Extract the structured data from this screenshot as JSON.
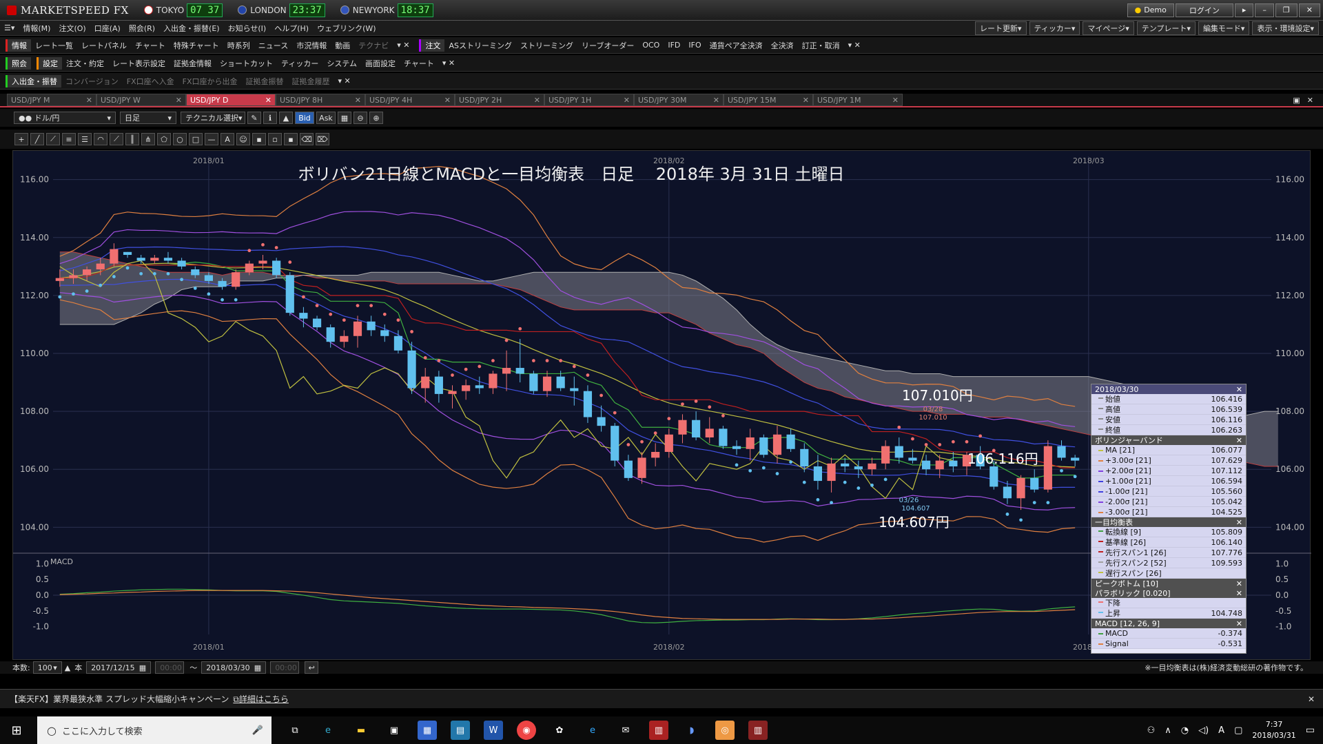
{
  "app": {
    "logo": "MARKETSPEED FX",
    "clocks": [
      {
        "city": "TOKYO",
        "time": "07 37",
        "color": "#cc2222"
      },
      {
        "city": "LONDON",
        "time": "23:37",
        "color": "#2244aa"
      },
      {
        "city": "NEWYORK",
        "time": "18:37",
        "color": "#2244aa"
      }
    ],
    "demo": "Demo",
    "login": "ログイン"
  },
  "menu": [
    "情報(M)",
    "注文(O)",
    "口座(A)",
    "照会(R)",
    "入出金・振替(E)",
    "お知らせ(I)",
    "ヘルプ(H)",
    "ウェブリンク(W)"
  ],
  "rightmenus": [
    "レート更新▾",
    "ティッカー▾",
    "マイページ▾",
    "テンプレート▾",
    "編集モード▾",
    "表示・環境設定▾"
  ],
  "toolbar1": {
    "group": "情報",
    "items": [
      "レート一覧",
      "レートパネル",
      "チャート",
      "特殊チャート",
      "時系列",
      "ニュース",
      "市況情報",
      "動画",
      "テクナビ"
    ],
    "group2": "注文",
    "items2": [
      "ASストリーミング",
      "ストリーミング",
      "リーブオーダー",
      "OCO",
      "IFD",
      "IFO",
      "通貨ペア全決済",
      "全決済",
      "訂正・取消"
    ]
  },
  "toolbar2": {
    "group": "照会",
    "group2": "設定",
    "items": [
      "注文・約定",
      "レート表示設定",
      "証拠金情報",
      "ショートカット",
      "ティッカー",
      "システム",
      "画面設定",
      "チャート"
    ]
  },
  "toolbar3": {
    "group": "入出金・振替",
    "items": [
      "コンバージョン",
      "FX口座へ入金",
      "FX口座から出金",
      "証拠金振替",
      "証拠金履歴"
    ]
  },
  "tabs": [
    "USD/JPY M",
    "USD/JPY W",
    "USD/JPY D",
    "USD/JPY 8H",
    "USD/JPY 4H",
    "USD/JPY 2H",
    "USD/JPY 1H",
    "USD/JPY 30M",
    "USD/JPY 15M",
    "USD/JPY 1M"
  ],
  "controls": {
    "pair": "ドル/円",
    "period": "日足",
    "tech": "テクニカル選択",
    "bid": "Bid",
    "ask": "Ask"
  },
  "chart_data": {
    "type": "candlestick",
    "title": "ボリバン21日線とMACDと一目均衡表　日足　 2018年 3月 31日 土曜日",
    "ylim": [
      103.2,
      116.8
    ],
    "yticks": [
      "116.00",
      "114.00",
      "112.00",
      "110.00",
      "108.00",
      "106.00",
      "104.00"
    ],
    "xticks": [
      "2018/01",
      "2018/02",
      "2018/03"
    ],
    "xtick_index": [
      11,
      45,
      76
    ],
    "annotations": {
      "high_label": "107.010円",
      "high_small": "03/28",
      "high_small2": "107.010",
      "close_label": "106.116円",
      "low_label": "104.607円",
      "low_small": "03/26",
      "low_small2": "104.607"
    },
    "candles": [
      [
        112.5,
        112.9,
        112.3,
        112.6
      ],
      [
        112.6,
        112.9,
        112.4,
        112.7
      ],
      [
        112.7,
        113.0,
        112.5,
        112.9
      ],
      [
        112.9,
        113.3,
        112.7,
        113.1
      ],
      [
        113.1,
        113.8,
        113.0,
        113.6
      ],
      [
        113.5,
        113.5,
        113.3,
        113.4
      ],
      [
        113.3,
        113.4,
        113.1,
        113.2
      ],
      [
        113.2,
        113.4,
        113.1,
        113.3
      ],
      [
        113.3,
        113.5,
        113.1,
        113.2
      ],
      [
        113.2,
        113.3,
        112.9,
        113.0
      ],
      [
        112.9,
        113.0,
        112.6,
        112.7
      ],
      [
        112.7,
        112.8,
        112.4,
        112.5
      ],
      [
        112.5,
        112.6,
        112.2,
        112.3
      ],
      [
        112.3,
        112.9,
        112.2,
        112.8
      ],
      [
        112.8,
        113.2,
        112.7,
        113.1
      ],
      [
        113.1,
        113.4,
        112.9,
        113.2
      ],
      [
        113.2,
        113.3,
        112.6,
        112.7
      ],
      [
        112.7,
        112.8,
        111.3,
        111.4
      ],
      [
        111.4,
        111.6,
        110.9,
        111.2
      ],
      [
        111.2,
        111.3,
        110.8,
        110.9
      ],
      [
        110.9,
        111.0,
        110.2,
        110.4
      ],
      [
        110.4,
        110.8,
        110.2,
        110.6
      ],
      [
        110.6,
        111.3,
        110.2,
        111.1
      ],
      [
        111.1,
        111.3,
        110.6,
        110.8
      ],
      [
        110.8,
        111.0,
        110.4,
        110.6
      ],
      [
        110.6,
        110.8,
        110.0,
        110.1
      ],
      [
        110.1,
        110.4,
        108.6,
        108.8
      ],
      [
        108.8,
        109.5,
        108.3,
        109.2
      ],
      [
        109.2,
        109.4,
        108.3,
        108.6
      ],
      [
        108.6,
        108.9,
        108.1,
        108.7
      ],
      [
        108.7,
        109.1,
        108.4,
        108.9
      ],
      [
        108.9,
        109.2,
        108.6,
        108.8
      ],
      [
        108.8,
        109.4,
        108.6,
        109.3
      ],
      [
        109.3,
        110.1,
        108.7,
        109.5
      ],
      [
        109.5,
        110.5,
        109.0,
        109.3
      ],
      [
        109.3,
        109.4,
        108.6,
        108.7
      ],
      [
        108.7,
        109.4,
        108.5,
        109.2
      ],
      [
        109.2,
        109.4,
        108.7,
        108.8
      ],
      [
        108.8,
        109.2,
        108.2,
        108.7
      ],
      [
        108.7,
        108.9,
        107.6,
        107.8
      ],
      [
        107.8,
        108.2,
        107.3,
        107.5
      ],
      [
        107.5,
        107.6,
        106.1,
        106.3
      ],
      [
        106.3,
        106.5,
        105.6,
        105.7
      ],
      [
        105.7,
        106.6,
        105.5,
        106.4
      ],
      [
        106.4,
        106.9,
        106.1,
        106.6
      ],
      [
        106.6,
        107.4,
        106.4,
        107.2
      ],
      [
        107.2,
        107.9,
        106.9,
        107.7
      ],
      [
        107.7,
        108.0,
        107.0,
        107.1
      ],
      [
        107.1,
        107.8,
        106.9,
        107.4
      ],
      [
        107.4,
        107.5,
        106.7,
        106.8
      ],
      [
        106.8,
        107.0,
        106.5,
        106.7
      ],
      [
        106.7,
        107.4,
        106.3,
        107.1
      ],
      [
        107.1,
        107.2,
        106.4,
        106.5
      ],
      [
        106.5,
        107.5,
        106.2,
        107.2
      ],
      [
        107.2,
        107.4,
        106.6,
        106.7
      ],
      [
        106.7,
        106.9,
        105.9,
        106.1
      ],
      [
        106.1,
        106.5,
        105.3,
        105.6
      ],
      [
        105.6,
        106.4,
        105.2,
        106.2
      ],
      [
        106.2,
        106.4,
        105.9,
        106.1
      ],
      [
        106.1,
        106.3,
        105.7,
        106.0
      ],
      [
        106.0,
        106.4,
        105.8,
        106.2
      ],
      [
        106.2,
        107.0,
        106.0,
        106.8
      ],
      [
        106.8,
        107.1,
        106.2,
        106.4
      ],
      [
        106.4,
        106.7,
        106.2,
        106.3
      ],
      [
        106.3,
        106.5,
        105.8,
        106.0
      ],
      [
        106.0,
        106.5,
        105.7,
        106.3
      ],
      [
        106.3,
        106.6,
        105.9,
        106.1
      ],
      [
        106.1,
        106.6,
        105.8,
        106.5
      ],
      [
        106.5,
        106.8,
        106.0,
        106.1
      ],
      [
        106.1,
        106.3,
        105.3,
        105.4
      ],
      [
        105.4,
        105.6,
        104.8,
        105.0
      ],
      [
        105.0,
        105.8,
        104.6,
        105.7
      ],
      [
        105.7,
        106.0,
        105.2,
        105.3
      ],
      [
        105.3,
        107.0,
        105.2,
        106.8
      ],
      [
        106.8,
        107.0,
        106.3,
        106.4
      ],
      [
        106.4,
        106.5,
        106.1,
        106.3
      ]
    ],
    "cloud": {
      "span_a": [
        113.5,
        113.5,
        113.4,
        113.3,
        113.2,
        113.1,
        113.0,
        112.9,
        112.8,
        112.8,
        112.8,
        112.8,
        112.7,
        112.8,
        112.8,
        112.8,
        112.7,
        112.7,
        112.7,
        112.6,
        112.6,
        112.5,
        112.5,
        112.5,
        112.5,
        112.4,
        112.4,
        112.4,
        112.4,
        112.4,
        112.4,
        112.4,
        112.4,
        112.3,
        112.2,
        112.0,
        111.8,
        111.6,
        111.5,
        111.5,
        111.5,
        111.5,
        111.5,
        111.5,
        111.4,
        111.4,
        111.2,
        111.0,
        110.7,
        110.5,
        110.3,
        110.2,
        110.0,
        109.6,
        109.3,
        109.0,
        108.8,
        108.7,
        108.5,
        108.4,
        108.3,
        108.2,
        108.1,
        108.0,
        108.0,
        107.9,
        107.9,
        107.9,
        107.8,
        107.8,
        107.8,
        107.7,
        107.6,
        107.5,
        107.4,
        107.3,
        107.2,
        107.1,
        107.0,
        107.0,
        106.9,
        106.9,
        106.8,
        106.7,
        106.6,
        106.5,
        106.4,
        106.3,
        106.2,
        106.1,
        106.1
      ],
      "span_b": [
        111.0,
        111.0,
        111.0,
        111.0,
        111.0,
        111.2,
        111.4,
        111.7,
        111.9,
        112.2,
        112.3,
        112.3,
        112.3,
        112.5,
        112.5,
        112.5,
        112.6,
        112.6,
        112.7,
        112.7,
        112.7,
        112.7,
        112.7,
        112.8,
        112.8,
        112.8,
        112.8,
        112.8,
        112.8,
        112.7,
        112.6,
        112.5,
        112.5,
        112.6,
        112.7,
        112.8,
        112.8,
        112.8,
        112.8,
        112.8,
        112.8,
        112.8,
        112.8,
        112.8,
        112.8,
        112.8,
        112.7,
        112.5,
        112.2,
        111.9,
        111.5,
        111.0,
        110.6,
        110.3,
        110.1,
        110.0,
        109.9,
        109.8,
        109.7,
        109.6,
        109.5,
        109.4,
        109.4,
        109.3,
        109.3,
        109.3,
        109.2,
        109.2,
        109.2,
        109.2,
        109.2,
        109.2,
        109.2,
        109.2,
        109.2,
        109.2,
        109.2,
        109.1,
        109.0,
        108.9,
        108.8,
        108.7,
        108.4,
        108.0,
        107.7,
        107.6,
        107.6,
        107.8,
        107.9,
        108.0,
        108.0
      ]
    },
    "macd": {
      "ylim": [
        -1.25,
        1.25
      ],
      "yticks": [
        "1.0",
        "0.5",
        "0.0",
        "-0.5",
        "-1.0"
      ],
      "macd": [
        0.03,
        0.05,
        0.08,
        0.1,
        0.13,
        0.15,
        0.17,
        0.18,
        0.19,
        0.19,
        0.18,
        0.17,
        0.15,
        0.14,
        0.14,
        0.14,
        0.12,
        0.06,
        0.0,
        -0.07,
        -0.14,
        -0.18,
        -0.2,
        -0.22,
        -0.24,
        -0.26,
        -0.3,
        -0.34,
        -0.37,
        -0.4,
        -0.42,
        -0.43,
        -0.44,
        -0.44,
        -0.44,
        -0.45,
        -0.46,
        -0.47,
        -0.5,
        -0.55,
        -0.62,
        -0.72,
        -0.82,
        -0.87,
        -0.88,
        -0.86,
        -0.83,
        -0.81,
        -0.8,
        -0.79,
        -0.79,
        -0.78,
        -0.78,
        -0.76,
        -0.75,
        -0.76,
        -0.78,
        -0.78,
        -0.77,
        -0.75,
        -0.72,
        -0.68,
        -0.63,
        -0.59,
        -0.56,
        -0.52,
        -0.49,
        -0.46,
        -0.44,
        -0.45,
        -0.49,
        -0.51,
        -0.5,
        -0.44,
        -0.4,
        -0.37
      ],
      "signal": [
        0.02,
        0.03,
        0.04,
        0.06,
        0.07,
        0.09,
        0.1,
        0.12,
        0.13,
        0.14,
        0.15,
        0.15,
        0.15,
        0.15,
        0.15,
        0.15,
        0.14,
        0.13,
        0.11,
        0.08,
        0.04,
        0.0,
        -0.04,
        -0.08,
        -0.11,
        -0.14,
        -0.17,
        -0.2,
        -0.23,
        -0.26,
        -0.29,
        -0.32,
        -0.34,
        -0.36,
        -0.37,
        -0.39,
        -0.4,
        -0.41,
        -0.43,
        -0.45,
        -0.48,
        -0.52,
        -0.57,
        -0.63,
        -0.68,
        -0.71,
        -0.74,
        -0.75,
        -0.76,
        -0.77,
        -0.77,
        -0.77,
        -0.77,
        -0.77,
        -0.76,
        -0.76,
        -0.76,
        -0.77,
        -0.77,
        -0.76,
        -0.76,
        -0.74,
        -0.72,
        -0.69,
        -0.67,
        -0.64,
        -0.61,
        -0.58,
        -0.55,
        -0.53,
        -0.52,
        -0.52,
        -0.52,
        -0.5,
        -0.48,
        -0.46
      ]
    },
    "colors": {
      "up": "#f07070",
      "down": "#60c0ee",
      "bg": "#0d1228",
      "cloud": "#9a9aa0"
    }
  },
  "panel": {
    "date": "2018/03/30",
    "ohlc": [
      {
        "k": "始値",
        "v": "106.416"
      },
      {
        "k": "高値",
        "v": "106.539"
      },
      {
        "k": "安値",
        "v": "106.116"
      },
      {
        "k": "終値",
        "v": "106.263"
      }
    ],
    "bb_title": "ボリンジャーバンド",
    "bb": [
      {
        "k": "MA [21]",
        "v": "106.077",
        "c": "#c0c040"
      },
      {
        "k": "+3.00σ [21]",
        "v": "107.629",
        "c": "#e08040"
      },
      {
        "k": "+2.00σ [21]",
        "v": "107.112",
        "c": "#8040e0"
      },
      {
        "k": "+1.00σ [21]",
        "v": "106.594",
        "c": "#4040e0"
      },
      {
        "k": "-1.00σ [21]",
        "v": "105.560",
        "c": "#4040e0"
      },
      {
        "k": "-2.00σ [21]",
        "v": "105.042",
        "c": "#8040e0"
      },
      {
        "k": "-3.00σ [21]",
        "v": "104.525",
        "c": "#e08040"
      }
    ],
    "ich_title": "一目均衡表",
    "ich": [
      {
        "k": "転換線 [9]",
        "v": "105.809",
        "c": "#40a040"
      },
      {
        "k": "基準線 [26]",
        "v": "106.140",
        "c": "#c02020"
      },
      {
        "k": "先行スパン1 [26]",
        "v": "107.776",
        "c": "#c02020"
      },
      {
        "k": "先行スパン2 [52]",
        "v": "109.593",
        "c": "#a0a0a0"
      },
      {
        "k": "遅行スパン [26]",
        "v": "",
        "c": "#c0c040"
      }
    ],
    "pb_title": "ピークボトム [10]",
    "psar_title": "パラボリック [0.020]",
    "psar": [
      {
        "k": "下降",
        "v": "",
        "c": "#f07070"
      },
      {
        "k": "上昇",
        "v": "104.748",
        "c": "#60c0ee"
      }
    ],
    "macd_title": "MACD [12, 26, 9]",
    "macd": [
      {
        "k": "MACD",
        "v": "-0.374",
        "c": "#40a040"
      },
      {
        "k": "Signal",
        "v": "-0.531",
        "c": "#e08040"
      }
    ]
  },
  "footer": {
    "count_label": "本数:",
    "count": "100",
    "unit": "本",
    "from": "2017/12/15",
    "to": "2018/03/30",
    "tilde": "〜",
    "copyright": "※一目均衡表は(株)経済変動総研の著作物です。"
  },
  "news": {
    "text": "【楽天FX】業界最狭水準 スプレッド大幅縮小キャンペーン",
    "link": "詳細はこちら"
  },
  "taskbar": {
    "search": "ここに入力して検索",
    "time": "7:37",
    "date": "2018/03/31",
    "ime": "A"
  }
}
